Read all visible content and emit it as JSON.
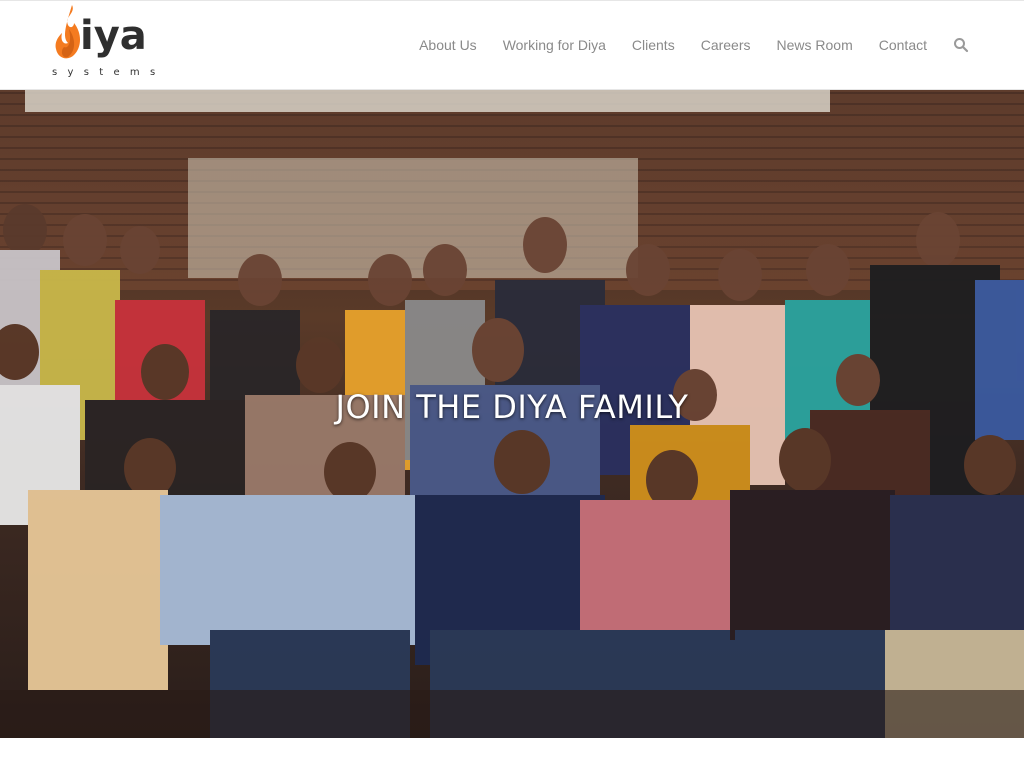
{
  "brand": {
    "name": "iya",
    "initial": "D",
    "tagline": "systems",
    "accent_color": "#f47b20"
  },
  "nav": {
    "items": [
      {
        "label": "About Us"
      },
      {
        "label": "Working for Diya"
      },
      {
        "label": "Clients"
      },
      {
        "label": "Careers"
      },
      {
        "label": "News Room"
      },
      {
        "label": "Contact"
      }
    ],
    "search_icon": "search-icon"
  },
  "hero": {
    "caption": "JOIN THE DIYA FAMILY",
    "image": "group-photo-of-team"
  }
}
